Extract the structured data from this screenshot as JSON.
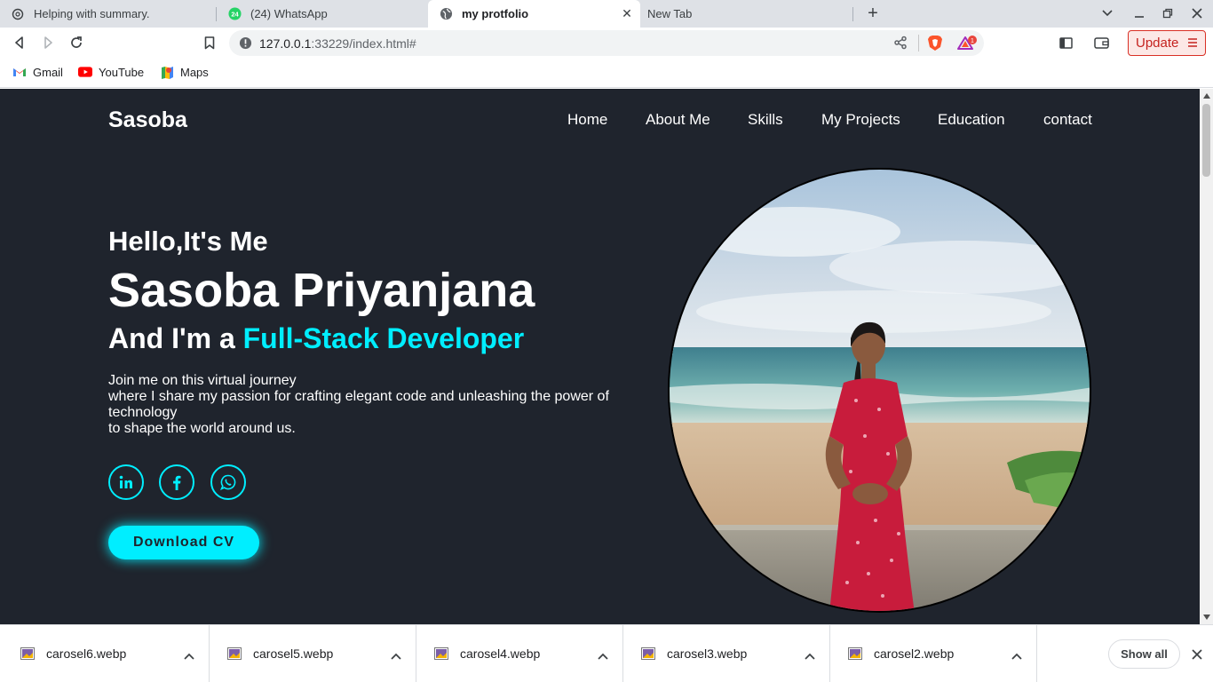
{
  "tabs": [
    {
      "title": "Helping with summary.",
      "icon": "chatgpt-icon",
      "active": false
    },
    {
      "title": "(24) WhatsApp",
      "icon": "whatsapp-icon",
      "badge": "24",
      "active": false
    },
    {
      "title": "my protfolio",
      "icon": "globe-icon",
      "active": true
    },
    {
      "title": "New Tab",
      "icon": "none",
      "active": false
    }
  ],
  "toolbar": {
    "url_host": "127.0.0.1",
    "url_rest": ":33229/index.html#",
    "update_label": "Update",
    "brave_badge": "1"
  },
  "bookmarks": [
    {
      "label": "Gmail",
      "icon": "gmail-icon"
    },
    {
      "label": "YouTube",
      "icon": "youtube-icon"
    },
    {
      "label": "Maps",
      "icon": "maps-icon"
    }
  ],
  "page": {
    "logo": "Sasoba",
    "nav": [
      "Home",
      "About Me",
      "Skills",
      "My Projects",
      "Education",
      "contact"
    ],
    "hello": "Hello,It's Me",
    "name": "Sasoba Priyanjana",
    "role_prefix": "And I'm a ",
    "role_accent": "Full-Stack Developer",
    "bio": [
      "Join me on this virtual journey",
      "where I share my passion for crafting elegant code and unleashing the power of technology",
      "to shape the world around us."
    ],
    "social": [
      "linkedin-icon",
      "facebook-icon",
      "whatsapp-icon"
    ],
    "cv_button": "Download CV",
    "accent_color": "#00eeff",
    "background_color": "#1f242d"
  },
  "downloads": {
    "items": [
      "carosel6.webp",
      "carosel5.webp",
      "carosel4.webp",
      "carosel3.webp",
      "carosel2.webp"
    ],
    "show_all": "Show all"
  }
}
